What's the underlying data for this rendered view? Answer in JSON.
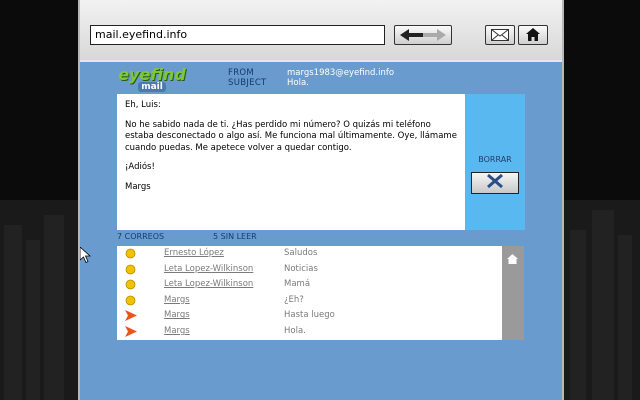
{
  "browser": {
    "url": "mail.eyefind.info",
    "nav_icon": "back-forward-arrows-icon",
    "mail_icon": "envelope-icon",
    "home_icon": "house-icon"
  },
  "logo": {
    "big": "eyefind",
    "small": "mail"
  },
  "header": {
    "from_label": "FROM",
    "subject_label": "SUBJECT",
    "from_value": "margs1983@eyefind.info",
    "subject_value": "Hola."
  },
  "message": {
    "greeting": "Eh, Luis:",
    "body": "No he sabido nada de ti. ¿Has perdido mi número? O quizás mi teléfono estaba desconectado o algo así. Me funciona mal últimamente. Oye, llámame cuando puedas. Me apetece volver a quedar contigo.",
    "closing": "¡Adiós!",
    "signature": "Margs"
  },
  "actions": {
    "delete_label": "BORRAR",
    "delete_icon": "x-icon"
  },
  "counts": {
    "total": "7 CORREOS",
    "unread": "5 SIN LEER"
  },
  "inbox": [
    {
      "icon": "yellow-dot-icon",
      "from": "Ernesto López",
      "subject": "Saludos"
    },
    {
      "icon": "yellow-dot-icon",
      "from": "Leta Lopez-Wilkinson",
      "subject": "Noticias"
    },
    {
      "icon": "yellow-dot-icon",
      "from": "Leta Lopez-Wilkinson",
      "subject": "Mamá"
    },
    {
      "icon": "yellow-dot-icon",
      "from": "Margs",
      "subject": "¿Eh?"
    },
    {
      "icon": "orange-arrow-icon",
      "from": "Margs",
      "subject": "Hasta luego"
    },
    {
      "icon": "orange-arrow-icon",
      "from": "Margs",
      "subject": "Hola."
    }
  ],
  "colors": {
    "content_bg": "#6a9bce",
    "side_panel": "#5ab8f0",
    "unread_dot": "#f2c200",
    "read_arrow": "#e8541c",
    "logo_green": "#7ec836"
  }
}
